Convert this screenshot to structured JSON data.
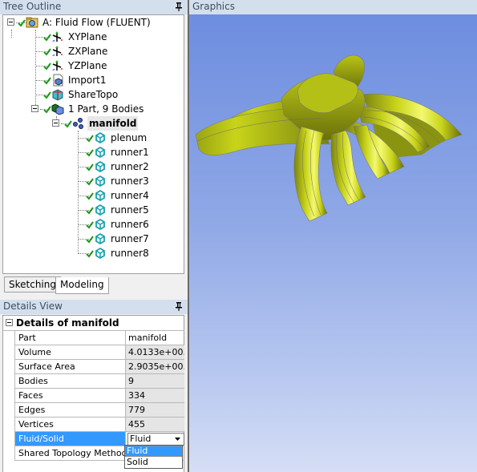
{
  "tree_outline": {
    "title": "Tree Outline",
    "nodes": [
      {
        "label": "A: Fluid Flow (FLUENT)",
        "icon": "project-icon"
      },
      {
        "label": "XYPlane",
        "icon": "plane-axes-icon"
      },
      {
        "label": "ZXPlane",
        "icon": "plane-axes-icon"
      },
      {
        "label": "YZPlane",
        "icon": "plane-axes-icon"
      },
      {
        "label": "Import1",
        "icon": "import-icon"
      },
      {
        "label": "ShareTopo",
        "icon": "share-topology-icon"
      },
      {
        "label": "1 Part, 9 Bodies",
        "icon": "parts-bodies-icon"
      },
      {
        "label": "manifold",
        "icon": "multibody-part-icon"
      },
      {
        "label": "plenum",
        "icon": "fluid-body-icon"
      },
      {
        "label": "runner1",
        "icon": "fluid-body-icon"
      },
      {
        "label": "runner2",
        "icon": "fluid-body-icon"
      },
      {
        "label": "runner3",
        "icon": "fluid-body-icon"
      },
      {
        "label": "runner4",
        "icon": "fluid-body-icon"
      },
      {
        "label": "runner5",
        "icon": "fluid-body-icon"
      },
      {
        "label": "runner6",
        "icon": "fluid-body-icon"
      },
      {
        "label": "runner7",
        "icon": "fluid-body-icon"
      },
      {
        "label": "runner8",
        "icon": "fluid-body-icon"
      }
    ]
  },
  "tabs": [
    {
      "label": "Sketching",
      "active": false
    },
    {
      "label": "Modeling",
      "active": true
    }
  ],
  "details_view": {
    "title": "Details View",
    "group_title": "Details of manifold",
    "rows": [
      {
        "key": "Part",
        "value": "manifold"
      },
      {
        "key": "Volume",
        "value": "4.0133e+00..."
      },
      {
        "key": "Surface Area",
        "value": "2.9035e+00..."
      },
      {
        "key": "Bodies",
        "value": "9"
      },
      {
        "key": "Faces",
        "value": "334"
      },
      {
        "key": "Edges",
        "value": "779"
      },
      {
        "key": "Vertices",
        "value": "455"
      },
      {
        "key": "Fluid/Solid",
        "value": "Fluid"
      },
      {
        "key": "Shared Topology Method",
        "value": ""
      }
    ],
    "dropdown": {
      "selected": "Fluid",
      "options": [
        "Fluid",
        "Solid"
      ]
    }
  },
  "graphics": {
    "title": "Graphics",
    "model_color": "#c8d41a"
  },
  "colors": {
    "header_bg": "#d4dfed",
    "selection": "#3399ff",
    "viewport_top": "#6d8ddf",
    "viewport_bottom": "#d5def5"
  }
}
